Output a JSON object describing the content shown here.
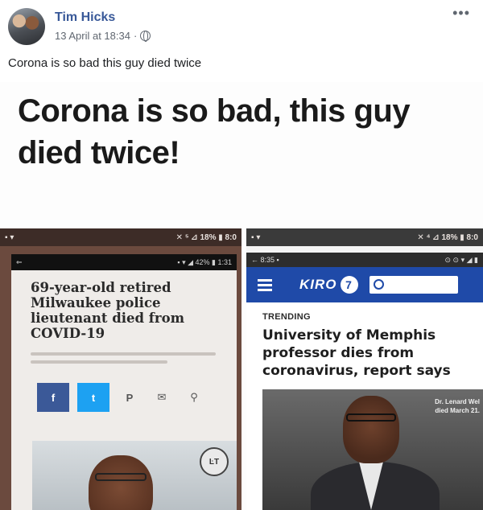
{
  "post": {
    "author": "Tim Hicks",
    "date": "13 April at 18:34",
    "separator": "·",
    "more_glyph": "•••",
    "caption": "Corona is so bad this guy died twice"
  },
  "meme": {
    "title_line1": "Corona is so bad, this guy",
    "title_line2": "died twice!",
    "left": {
      "status_left": "▪︎ ▾",
      "status_right": "✕ ⁵ ⊿ 18% ▮ 8:0",
      "inner_status": "▪ ▾ ◢ 42% ▮ 1:31",
      "headline_line1": "69-year-old retired",
      "headline_line2": "Milwaukee police",
      "headline_line3": "lieutenant died from",
      "headline_line4": "COVID-19",
      "share_fb": "f",
      "share_tw": "t",
      "share_pin": "P",
      "share_mail": "✉",
      "share_link": "⚲",
      "logo_text": "ĿT"
    },
    "right": {
      "status_left": "▪ ▾",
      "status_right": "✕ ⁴ ⊿ 18% ▮ 8:0",
      "tab_left": "← 8:35 ▪",
      "tab_right": "⊙ ⊙ ▾ ◢ ▮",
      "logo": "KIRO",
      "logo_num": "7",
      "trending": "TRENDING",
      "headline_line1": "University of Memphis",
      "headline_line2": "professor dies from",
      "headline_line3": "coronavirus, report says",
      "photo_caption_line1": "Dr. Lenard Wel",
      "photo_caption_line2": "died March 21."
    }
  },
  "colors": {
    "author": "#385898",
    "kiro_nav": "#1f4aa8",
    "facebook": "#3b5998",
    "twitter": "#1da1f2"
  }
}
